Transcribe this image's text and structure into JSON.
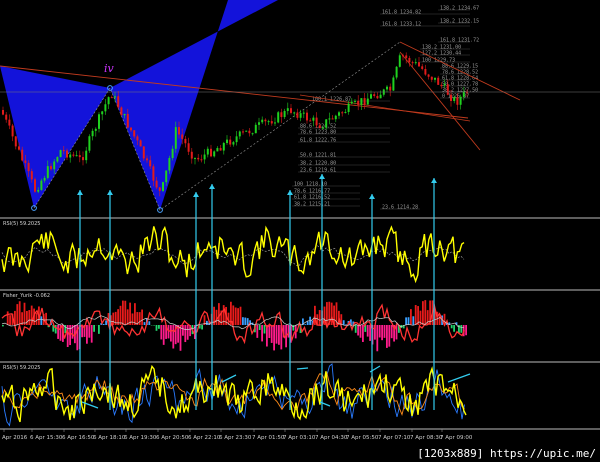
{
  "price_panel": {
    "wave_label": "iv",
    "fib_labels": [
      "161.8 1234.82",
      "138.2 1234.67",
      "161.8 1233.12",
      "138.2 1232.15",
      "161.8 1231.72",
      "138.2 1231.00",
      "127.2 1230.44",
      "100 1229.73",
      "88.6 1229.15",
      "78.6 1228.52",
      "61.8 1228.64",
      "50.0 1227.78",
      "38.2 1227.50",
      "0 1226.87",
      "100.1 1226.87",
      "88.6 1224.52",
      "78.6 1223.80",
      "61.8 1222.76",
      "50.0 1221.81",
      "38.2 1220.80",
      "23.6 1219.61",
      "100 1218.10",
      "78.6 1216.77",
      "61.8 1216.52",
      "38.2 1215.21",
      "23.6 1214.28"
    ]
  },
  "panels": {
    "rsi_title": "RSI(5) 59.2025",
    "fisher_title": "Fisher_Yurik -0.062",
    "rsi2_title": "RSI(5) 59.2025"
  },
  "time_axis": [
    "Apr 2016",
    "6 Apr 15:30",
    "6 Apr 16:50",
    "6 Apr 18:10",
    "6 Apr 19:30",
    "6 Apr 20:50",
    "6 Apr 22:10",
    "6 Apr 23:30",
    "7 Apr 01:50",
    "7 Apr 03:10",
    "7 Apr 04:30",
    "7 Apr 05:50",
    "7 Apr 07:10",
    "7 Apr 08:30",
    "7 Apr 09:00"
  ],
  "watermark": "[1203x889] https://upic.me/",
  "colors": {
    "background": "#000000",
    "pattern_fill": "#1414e6",
    "bull_candle": "#1fd11f",
    "bear_candle": "#e11b1b",
    "oscillator": "#ffff00",
    "arrow": "#33ccee",
    "trend_line": "#c23b1e"
  }
}
